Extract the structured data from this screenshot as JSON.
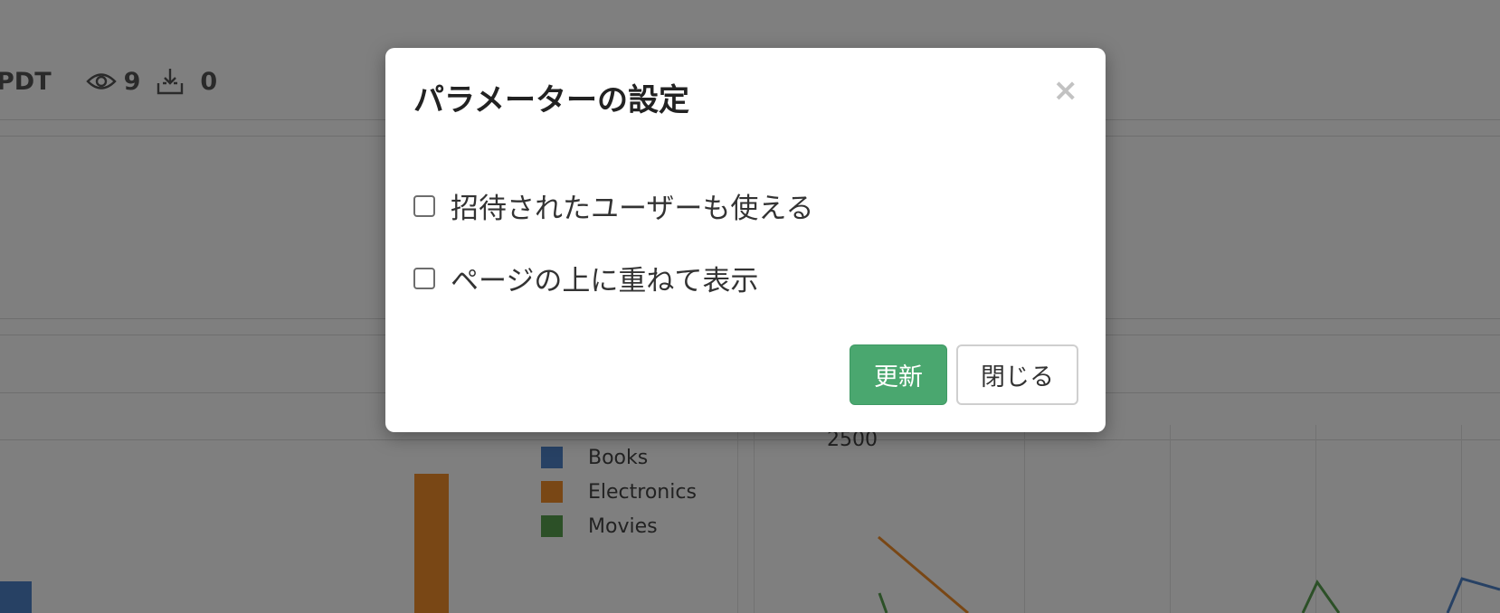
{
  "header": {
    "timezone_fragment": "PDT",
    "view_count": "9",
    "download_count": "0"
  },
  "chart": {
    "y_tick": "2500",
    "legend": [
      {
        "label": "Books",
        "color": "#4e82c8"
      },
      {
        "label": "Electronics",
        "color": "#f28e2b"
      },
      {
        "label": "Movies",
        "color": "#59a14f"
      }
    ]
  },
  "modal": {
    "title": "パラメーターの設定",
    "close_symbol": "×",
    "options": [
      {
        "label": "招待されたユーザーも使える",
        "checked": false
      },
      {
        "label": "ページの上に重ねて表示",
        "checked": false
      }
    ],
    "update_label": "更新",
    "close_label": "閉じる",
    "update_color": "#4aa76f"
  }
}
